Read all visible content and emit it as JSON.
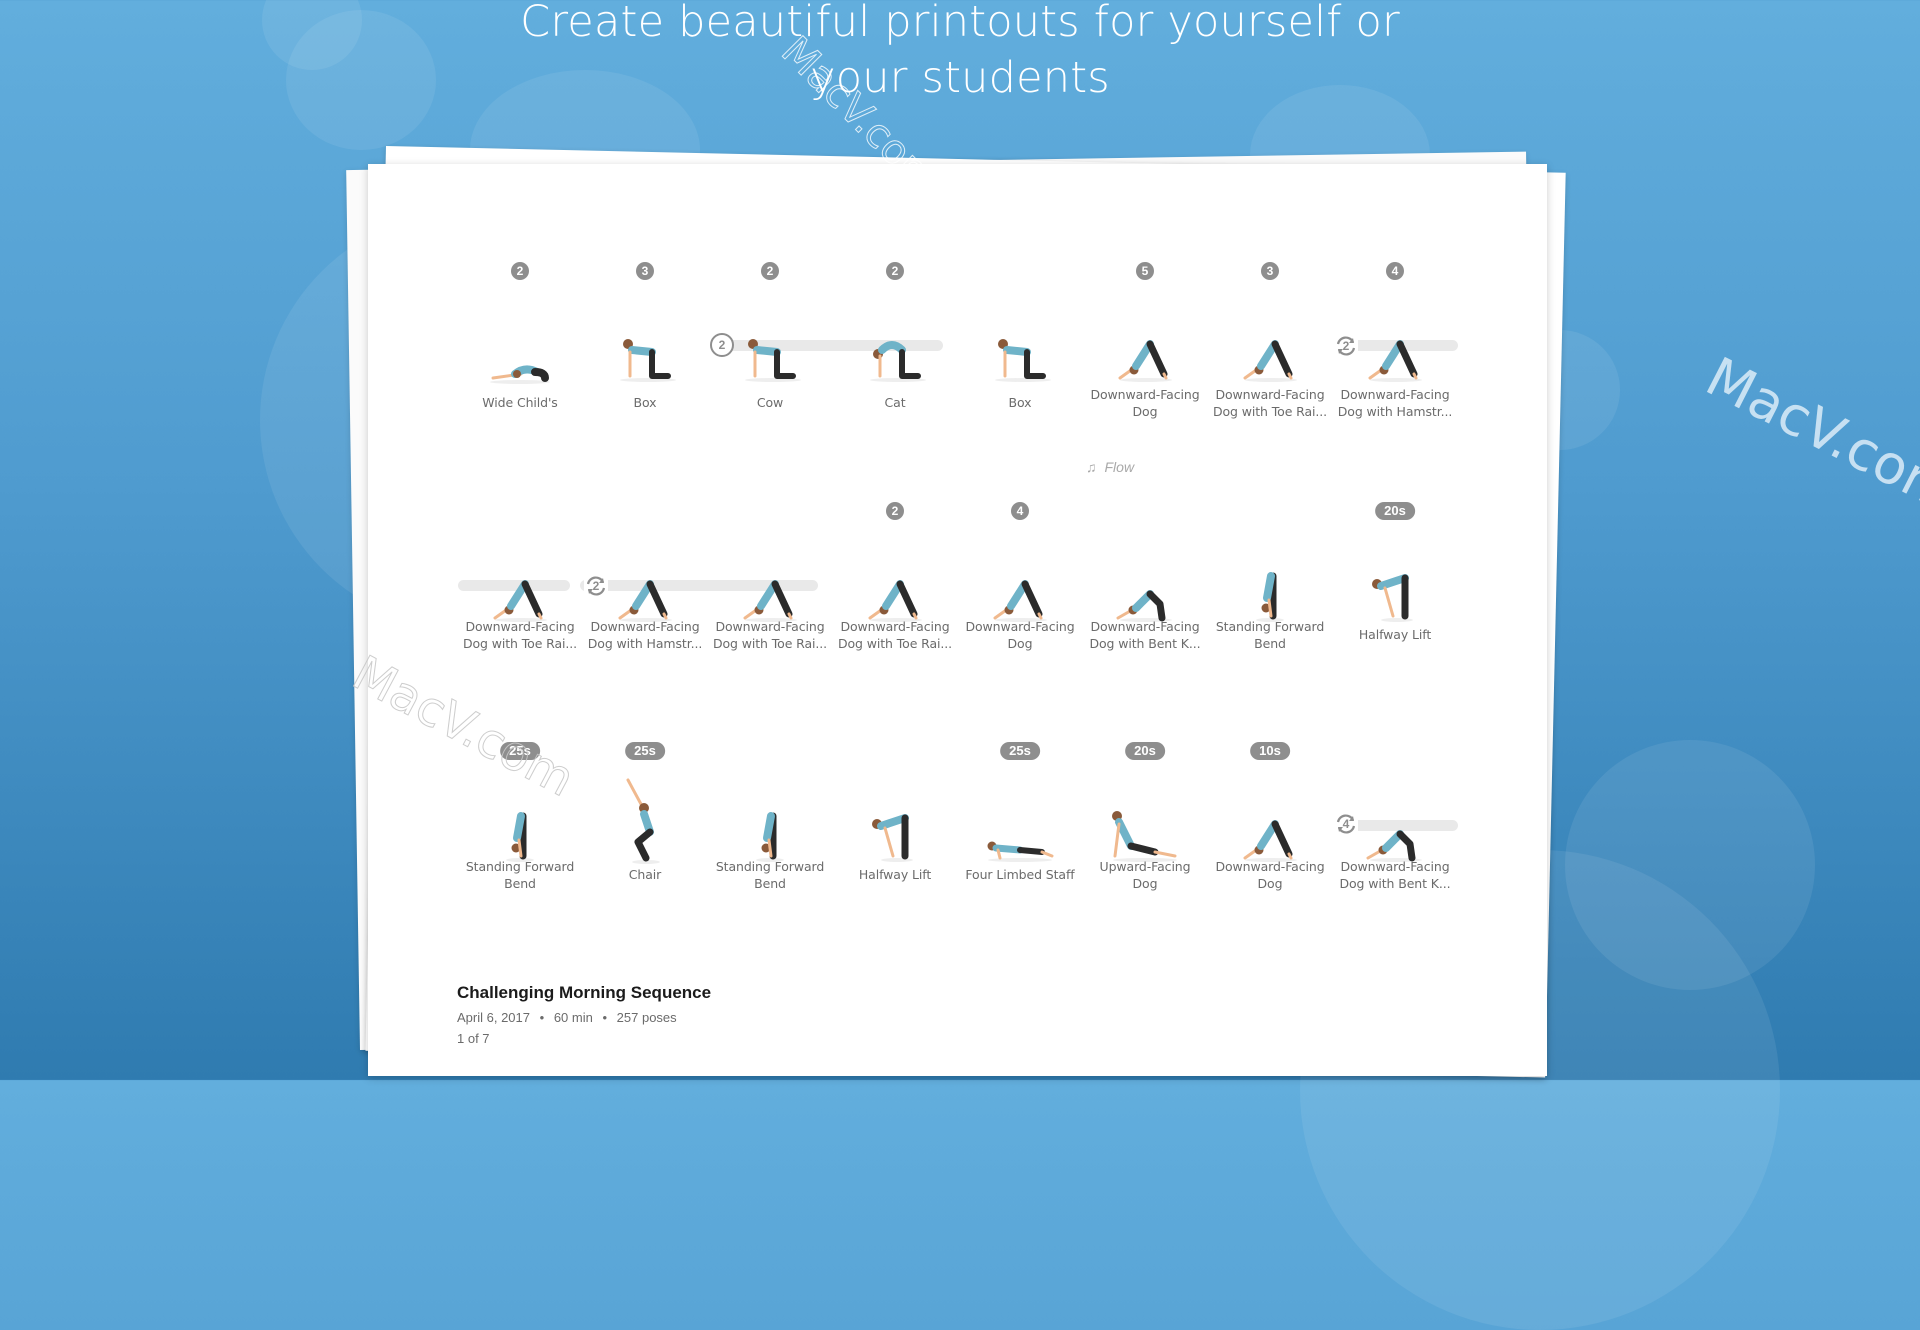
{
  "headline": {
    "line1": "Create beautiful printouts for yourself or",
    "line2": "your students"
  },
  "flow_label": "Flow",
  "rows": [
    {
      "poses": [
        {
          "badge": "2",
          "label1": "Wide Child's",
          "label2": "",
          "figure": "childs"
        },
        {
          "badge": "3",
          "label1": "Box",
          "label2": "",
          "figure": "box"
        },
        {
          "badge": "2",
          "label1": "Cow",
          "label2": "",
          "figure": "box"
        },
        {
          "badge": "2",
          "label1": "Cat",
          "label2": "",
          "figure": "cat"
        },
        {
          "badge": "",
          "label1": "Box",
          "label2": "",
          "figure": "box"
        },
        {
          "badge": "5",
          "label1": "Downward-Facing",
          "label2": "Dog",
          "figure": "dog"
        },
        {
          "badge": "3",
          "label1": "Downward-Facing",
          "label2": "Dog with Toe Rai...",
          "figure": "dog"
        },
        {
          "badge": "4",
          "label1": "Downward-Facing",
          "label2": "Dog with Hamstr...",
          "figure": "dog"
        }
      ],
      "repeat_groups": [
        {
          "count": "2",
          "style": "circle"
        },
        {
          "count": "2",
          "style": "cycle"
        }
      ]
    },
    {
      "poses": [
        {
          "badge": "",
          "label1": "Downward-Facing",
          "label2": "Dog with Toe Rai...",
          "figure": "dog"
        },
        {
          "badge": "",
          "label1": "Downward-Facing",
          "label2": "Dog with Hamstr...",
          "figure": "dog"
        },
        {
          "badge": "",
          "label1": "Downward-Facing",
          "label2": "Dog with Toe Rai...",
          "figure": "dog"
        },
        {
          "badge": "2",
          "label1": "Downward-Facing",
          "label2": "Dog with Toe Rai...",
          "figure": "dog"
        },
        {
          "badge": "4",
          "label1": "Downward-Facing",
          "label2": "Dog",
          "figure": "dog"
        },
        {
          "badge": "",
          "label1": "Downward-Facing",
          "label2": "Dog with Bent K...",
          "figure": "dogbent"
        },
        {
          "badge": "",
          "label1": "Standing Forward",
          "label2": "Bend",
          "figure": "fold"
        },
        {
          "badge": "20s",
          "label1": "Halfway Lift",
          "label2": "",
          "figure": "halfway"
        }
      ],
      "repeat_groups": [
        {
          "count": "2",
          "style": "cycle"
        }
      ]
    },
    {
      "poses": [
        {
          "badge": "25s",
          "label1": "Standing Forward",
          "label2": "Bend",
          "figure": "fold"
        },
        {
          "badge": "25s",
          "label1": "Chair",
          "label2": "",
          "figure": "chair"
        },
        {
          "badge": "",
          "label1": "Standing Forward",
          "label2": "Bend",
          "figure": "fold"
        },
        {
          "badge": "",
          "label1": "Halfway Lift",
          "label2": "",
          "figure": "halfway"
        },
        {
          "badge": "25s",
          "label1": "Four Limbed Staff",
          "label2": "",
          "figure": "plank"
        },
        {
          "badge": "20s",
          "label1": "Upward-Facing",
          "label2": "Dog",
          "figure": "updog"
        },
        {
          "badge": "10s",
          "label1": "Downward-Facing",
          "label2": "Dog",
          "figure": "dog"
        },
        {
          "badge": "",
          "label1": "Downward-Facing",
          "label2": "Dog with Bent K...",
          "figure": "dogbent"
        }
      ],
      "repeat_groups": [
        {
          "count": "4",
          "style": "cycle"
        }
      ]
    }
  ],
  "sequence": {
    "title": "Challenging Morning Sequence",
    "date": "April 6, 2017",
    "duration": "60 min",
    "poses": "257 poses",
    "separator": "•",
    "page": "1 of 7"
  },
  "watermark": "MacV.com",
  "colors": {
    "badge": "#8e8e8e",
    "track": "#e9e9e9",
    "label": "#6b6b6b",
    "shirt": "#6fb3c8",
    "pants": "#2b2b2b",
    "skin": "#f0b98e",
    "hair": "#8a5a3a"
  }
}
